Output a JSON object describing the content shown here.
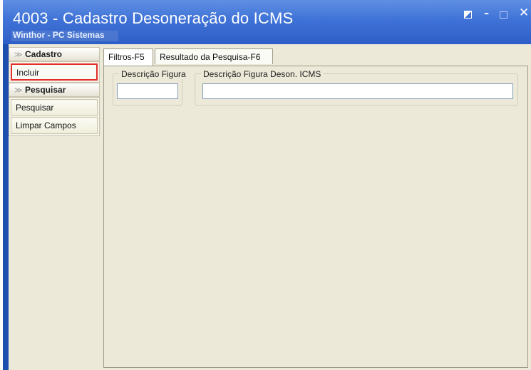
{
  "window": {
    "title": "4003 - Cadastro Desoneração do ICMS",
    "subtitle": "Winthor - PC Sistemas",
    "colors": {
      "titlebar": "#3f72d6",
      "highlight_border": "#e0302a"
    }
  },
  "sidebar": {
    "cadastro": {
      "label": "Cadastro",
      "items": [
        {
          "label": "Incluir"
        }
      ]
    },
    "pesquisar": {
      "label": "Pesquisar",
      "items": [
        {
          "label": "Pesquisar"
        },
        {
          "label": "Limpar Campos"
        }
      ]
    }
  },
  "tabs": [
    {
      "label": "Filtros-F5",
      "active": true
    },
    {
      "label": "Resultado da Pesquisa-F6",
      "active": false
    }
  ],
  "filters": {
    "descricao_figura": {
      "label": "Descrição Figura",
      "value": ""
    },
    "descricao_figura_deson": {
      "label": "Descrição Figura Deson. ICMS",
      "value": ""
    }
  }
}
